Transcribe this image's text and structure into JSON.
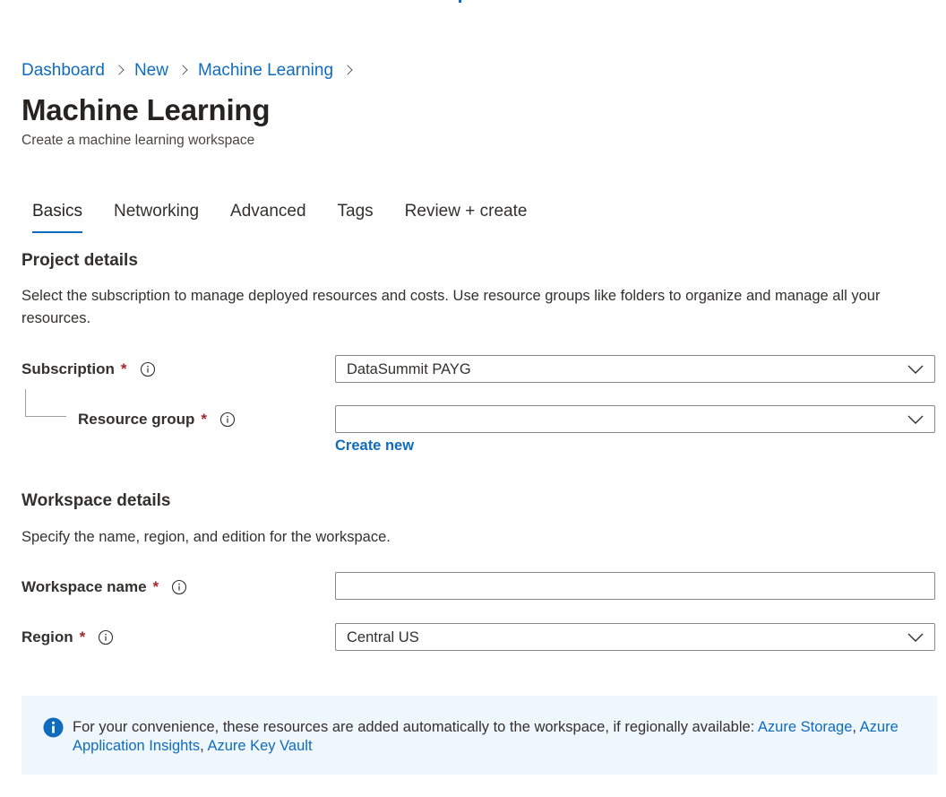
{
  "breadcrumb": {
    "items": [
      "Dashboard",
      "New",
      "Machine Learning"
    ]
  },
  "page": {
    "title": "Machine Learning",
    "subtitle": "Create a machine learning workspace"
  },
  "tabs": [
    {
      "label": "Basics",
      "active": true
    },
    {
      "label": "Networking",
      "active": false
    },
    {
      "label": "Advanced",
      "active": false
    },
    {
      "label": "Tags",
      "active": false
    },
    {
      "label": "Review + create",
      "active": false
    }
  ],
  "project_details": {
    "heading": "Project details",
    "description": "Select the subscription to manage deployed resources and costs. Use resource groups like folders to organize and manage all your resources.",
    "subscription": {
      "label": "Subscription",
      "required": "*",
      "value": "DataSummit PAYG"
    },
    "resource_group": {
      "label": "Resource group",
      "required": "*",
      "value": "",
      "create_new_label": "Create new"
    }
  },
  "workspace_details": {
    "heading": "Workspace details",
    "description": "Specify the name, region, and edition for the workspace.",
    "workspace_name": {
      "label": "Workspace name",
      "required": "*",
      "value": ""
    },
    "region": {
      "label": "Region",
      "required": "*",
      "value": "Central US"
    }
  },
  "info_box": {
    "text": "For your convenience, these resources are added automatically to the workspace, if regionally available: ",
    "links": [
      "Azure Storage",
      "Azure Application Insights",
      "Azure Key Vault"
    ],
    "separator": ", "
  },
  "colors": {
    "accent": "#0f6cbd",
    "required": "#a4262c",
    "info_background": "#eff6fc",
    "text": "#323130"
  },
  "icons": {
    "info": "info-circle-icon",
    "dropdown": "chevron-down-icon",
    "breadcrumb_separator": "chevron-right-icon",
    "info_filled": "info-filled-icon"
  }
}
